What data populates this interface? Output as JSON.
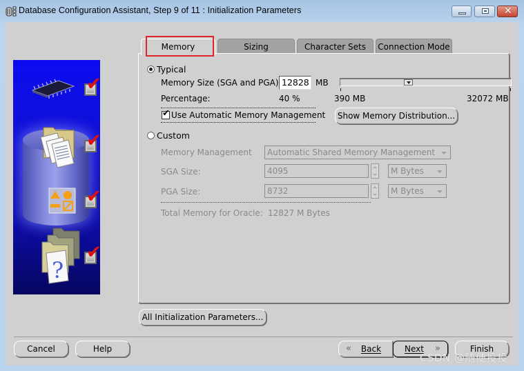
{
  "window": {
    "title": "Database Configuration Assistant, Step 9 of 11 : Initialization Parameters",
    "app_icon": "database-app-icon",
    "controls": {
      "minimize": "minimize-icon",
      "maximize": "maximize-icon",
      "close": "close-icon"
    },
    "close_glyph": "✕"
  },
  "sidebar_art": {
    "steps": [
      {
        "icon": "memory-chip-icon",
        "checked": true
      },
      {
        "icon": "documents-folder-icon",
        "checked": true
      },
      {
        "icon": "shapes-icon",
        "checked": true
      },
      {
        "icon": "help-document-icon",
        "checked": true
      }
    ],
    "check_glyph": "✔"
  },
  "tabs": [
    {
      "label": "Memory",
      "active": true
    },
    {
      "label": "Sizing",
      "active": false
    },
    {
      "label": "Character Sets",
      "active": false
    },
    {
      "label": "Connection Mode",
      "active": false
    }
  ],
  "memory": {
    "typical": {
      "label": "Typical",
      "selected": true,
      "memory_size_label": "Memory Size (SGA and PGA):",
      "memory_size_value": "12828",
      "memory_size_unit": "MB",
      "percentage_label": "Percentage:",
      "percentage_value": "40 %",
      "slider": {
        "min_label": "390 MB",
        "max_label": "32072 MB",
        "min": 390,
        "max": 32072,
        "value": 12828
      },
      "amm_checkbox_label": "Use Automatic Memory Management",
      "amm_checked": true,
      "amm_check_glyph": "✔",
      "show_distribution_button": "Show Memory Distribution..."
    },
    "custom": {
      "label": "Custom",
      "selected": false,
      "memory_management_label": "Memory Management",
      "memory_management_value": "Automatic Shared Memory Management",
      "sga_label": "SGA Size:",
      "sga_value": "4095",
      "sga_unit": "M Bytes",
      "pga_label": "PGA Size:",
      "pga_value": "8732",
      "pga_unit": "M Bytes",
      "total_label": "Total Memory for Oracle:",
      "total_value": "12827 M Bytes"
    }
  },
  "all_params_button": "All Initialization Parameters...",
  "footer": {
    "cancel": "Cancel",
    "help": "Help",
    "back": "Back",
    "back_glyph": "«",
    "next": "Next",
    "next_glyph": "»",
    "finish": "Finish"
  },
  "watermark": "CSDN @随便投投",
  "colors": {
    "tab_highlight": "#e0242c",
    "art_blue": "#0b0bf0",
    "check_red": "#e01010"
  }
}
